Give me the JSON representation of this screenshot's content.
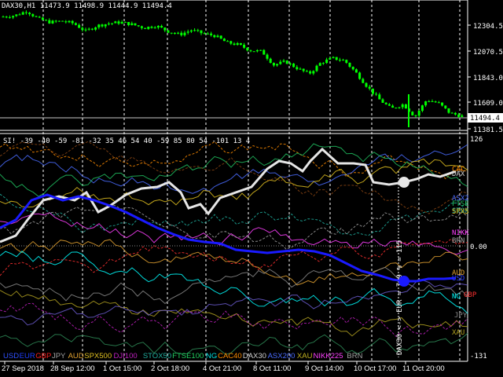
{
  "colors": {
    "background": "#000000",
    "grid": "#ffffff",
    "candles": "#00ff00",
    "main_line": "#e6e6e6",
    "usd_line": "#1a1aff",
    "price_box_bg": "#ffffff",
    "price_box_fg": "#000000"
  },
  "top_panel": {
    "header": "DAX30,H1  11473.9 11498.9 11444.9 11494.4",
    "current_price_label": "11494.4",
    "price_axis": [
      "12304.5",
      "12070.5",
      "11843.0",
      "11609.0",
      "11381.5"
    ]
  },
  "indicator_panel": {
    "header": "SI! -39 -40 -59 -81 -32 35 46 54 40 -59 85 80 54 -101 13 4",
    "axis_top": "126",
    "axis_zero": "0.00",
    "axis_bottom": "-131",
    "vertical_annotation": "DAX30 <-> EUR = 7.9 % = 115",
    "right_labels": [
      {
        "text": "CAC",
        "color": "#ff8c00"
      },
      {
        "text": "DAX",
        "color": "#d0d0d0"
      },
      {
        "text": "ASX2",
        "color": "#4a6cff"
      },
      {
        "text": "FTSE",
        "color": "#20c060"
      },
      {
        "text": "STOX",
        "color": "#20b0a0"
      },
      {
        "text": "SPX5",
        "color": "#e0c020"
      },
      {
        "text": "NIKK",
        "color": "#ff40ff"
      },
      {
        "text": "BRN",
        "color": "#a0a0a0"
      },
      {
        "text": "AUD",
        "color": "#e0a030"
      },
      {
        "text": "USD",
        "color": "#2a3cff"
      },
      {
        "text": "NG",
        "color": "#00ffff"
      },
      {
        "text": "GBP",
        "color": "#ff3030"
      },
      {
        "text": "JPY",
        "color": "#888888"
      },
      {
        "text": "XAU",
        "color": "#b0a020"
      }
    ],
    "legend": [
      {
        "text": "USD",
        "color": "#3050ff"
      },
      {
        "text": "EUR",
        "color": "#1e3cff"
      },
      {
        "text": "GBP",
        "color": "#ff2020"
      },
      {
        "text": "JPY",
        "color": "#a0a0a0"
      },
      {
        "text": "AUD",
        "color": "#e0a030"
      },
      {
        "text": "SPX500",
        "color": "#e0c020"
      },
      {
        "text": "DJI100",
        "color": "#c020c0"
      },
      {
        "text": "STOX50",
        "color": "#20b0a0"
      },
      {
        "text": "FTSE100",
        "color": "#20d060"
      },
      {
        "text": "NG",
        "color": "#00e0e0"
      },
      {
        "text": "CAC40",
        "color": "#ff8c00"
      },
      {
        "text": "DAX30",
        "color": "#d0d0d0"
      },
      {
        "text": "ASX200",
        "color": "#4a6cff"
      },
      {
        "text": "XAU",
        "color": "#c0b020"
      },
      {
        "text": "NIKK225",
        "color": "#ff40ff"
      },
      {
        "text": "BRN",
        "color": "#a0a0a0"
      }
    ]
  },
  "time_axis": [
    "27 Sep 2018",
    "28 Sep 12:00",
    "1 Oct 15:00",
    "2 Oct 18:00",
    "4 Oct 21:00",
    "8 Oct 11:00",
    "9 Oct 14:00",
    "10 Oct 17:00",
    "11 Oct 20:00"
  ],
  "price_data": {
    "type": "candlestick",
    "symbol": "DAX30",
    "timeframe": "H1",
    "ylim": [
      11381.5,
      12304.5
    ],
    "approx_close_path": [
      12380,
      12390,
      12430,
      12360,
      12330,
      12340,
      12320,
      12250,
      12300,
      12320,
      12330,
      12310,
      12280,
      12300,
      12250,
      12220,
      12260,
      12230,
      12210,
      12150,
      12130,
      12080,
      12070,
      11950,
      11980,
      11920,
      11870,
      11970,
      12010,
      11990,
      11880,
      11750,
      11640,
      11560,
      11600,
      11490,
      11640,
      11610,
      11520,
      11494.4
    ]
  }
}
